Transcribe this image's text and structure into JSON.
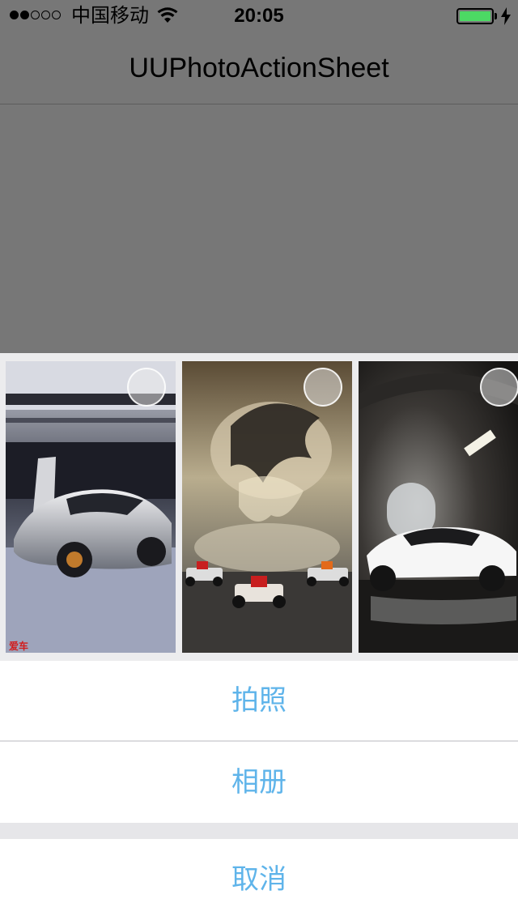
{
  "status_bar": {
    "carrier": "中国移动",
    "time": "20:05",
    "signal_strength": 2,
    "signal_max": 5,
    "battery_level": 1.0,
    "icons": [
      "signal-dots-icon",
      "wifi-icon",
      "battery-icon",
      "charging-bolt-icon"
    ],
    "battery_color": "#4cd964"
  },
  "nav": {
    "title": "UUPhotoActionSheet"
  },
  "photo_strip": {
    "photos": [
      {
        "name": "silver-sports-car-photo",
        "selected": false
      },
      {
        "name": "smoke-dragon-f1-cars-photo",
        "selected": false
      },
      {
        "name": "white-lamborghini-tunnel-photo",
        "selected": false
      }
    ],
    "icons": [
      "selection-circle-icon"
    ]
  },
  "action_sheet": {
    "camera_label": "拍照",
    "album_label": "相册",
    "cancel_label": "取消",
    "accent_color": "#5fb4ea"
  }
}
